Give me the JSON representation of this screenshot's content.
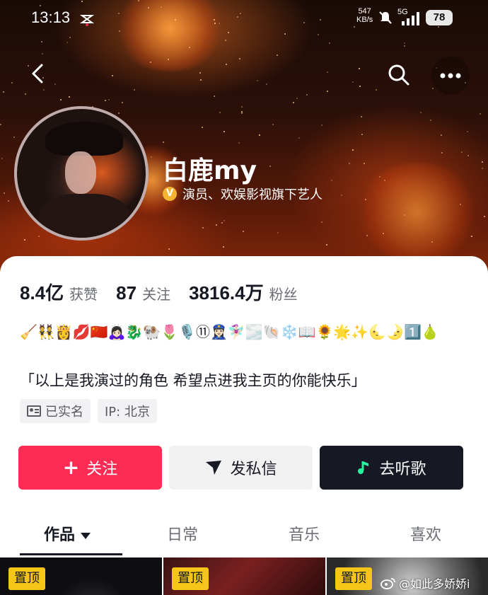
{
  "status_bar": {
    "time": "13:13",
    "net_speed_value": "547",
    "net_speed_unit": "KB/s",
    "network": "5G",
    "battery": "78"
  },
  "profile": {
    "username": "白鹿my",
    "verification": "演员、欢娱影视旗下艺人",
    "stats": [
      {
        "value": "8.4亿",
        "label": "获赞"
      },
      {
        "value": "87",
        "label": "关注"
      },
      {
        "value": "3816.4万",
        "label": "粉丝"
      }
    ],
    "emoji_line": "🧹👯👸💋🇨🇳🙇🏻‍♀️🐉🐏🌷🎙️⑪👮🏻‍♀️🧚🏻‍♀️🌫️🐚❄️📖🌻🌟✨🌜🌛1️⃣🍐",
    "bio": "「以上是我演过的角色 希望点进我主页的你能快乐」",
    "tags": {
      "verified_real_name": "已实名",
      "ip": "IP: 北京"
    }
  },
  "actions": {
    "follow": "关注",
    "message": "发私信",
    "music": "去听歌"
  },
  "tabs": [
    "作品",
    "日常",
    "音乐",
    "喜欢"
  ],
  "thumbnails": {
    "pin_label": "置顶"
  },
  "watermark": "@如此多娇娇i",
  "colors": {
    "follow_button": "#fe2c55",
    "music_button": "#161823",
    "pin_badge": "#f5c518",
    "verify_badge": "#f2b431"
  }
}
